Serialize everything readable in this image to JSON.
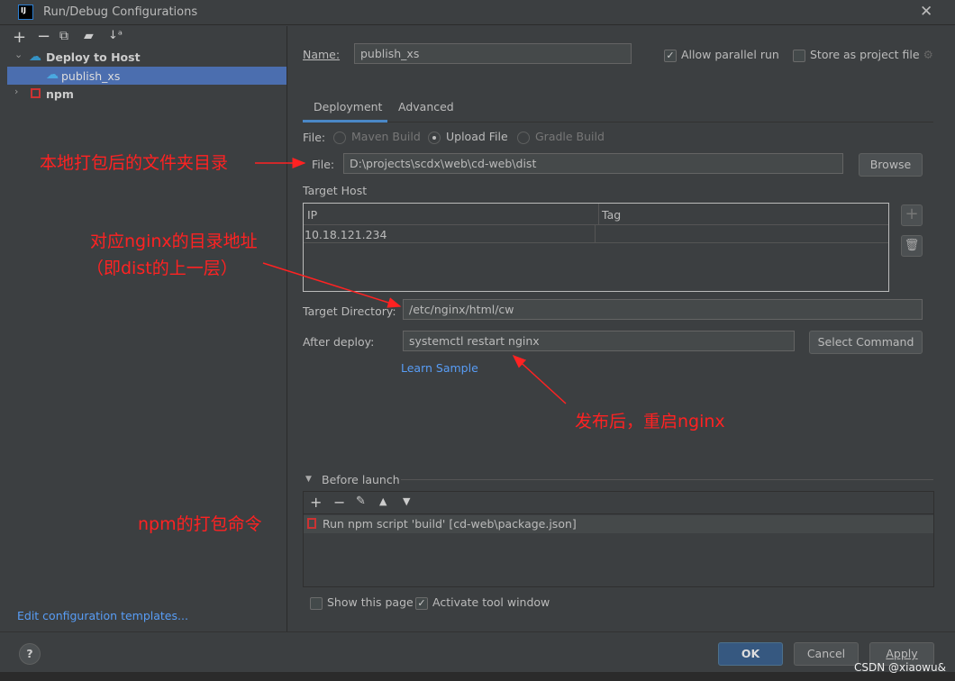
{
  "window": {
    "title": "Run/Debug Configurations",
    "close_icon": "close-icon"
  },
  "sidebar": {
    "toolbar": [
      "add-icon",
      "remove-icon",
      "copy-icon",
      "folder-add-icon",
      "sort-icon"
    ],
    "tree": [
      {
        "label": "Deploy to Host",
        "expanded": true,
        "children": [
          {
            "label": "publish_xs",
            "selected": true
          }
        ]
      },
      {
        "label": "npm",
        "expanded": false
      }
    ],
    "edit_templates": "Edit configuration templates..."
  },
  "form": {
    "name_label": "Name:",
    "name_value": "publish_xs",
    "allow_parallel": {
      "label": "Allow parallel run",
      "checked": true
    },
    "store_project": {
      "label": "Store as project file",
      "checked": false
    },
    "tabs": [
      {
        "label": "Deployment",
        "active": true
      },
      {
        "label": "Advanced",
        "active": false
      }
    ],
    "file_type_label": "File:",
    "file_types": [
      {
        "label": "Maven Build",
        "selected": false
      },
      {
        "label": "Upload File",
        "selected": true
      },
      {
        "label": "Gradle Build",
        "selected": false
      }
    ],
    "file_label": "File:",
    "file_value": "D:\\projects\\scdx\\web\\cd-web\\dist",
    "browse": "Browse",
    "target_host_label": "Target Host",
    "host_table": {
      "columns": [
        "IP",
        "Tag"
      ],
      "rows": [
        [
          "10.18.121.234",
          ""
        ]
      ]
    },
    "target_dir_label": "Target Directory:",
    "target_dir_value": "/etc/nginx/html/cw",
    "after_deploy_label": "After deploy:",
    "after_deploy_value": "systemctl restart nginx",
    "select_command": "Select Command",
    "learn_sample": "Learn Sample"
  },
  "before_launch": {
    "title": "Before launch",
    "items": [
      "Run npm script 'build' [cd-web\\package.json]"
    ],
    "show_page": {
      "label": "Show this page",
      "checked": false
    },
    "activate_tool": {
      "label": "Activate tool window",
      "checked": true
    }
  },
  "footer": {
    "help": "?",
    "ok": "OK",
    "cancel": "Cancel",
    "apply": "Apply"
  },
  "annotations": {
    "local_dir": "本地打包后的文件夹目录",
    "nginx_dir_1": "对应nginx的目录地址",
    "nginx_dir_2": "（即dist的上一层）",
    "restart": "发布后，重启nginx",
    "npm_cmd": "npm的打包命令",
    "color": "#ff2222"
  },
  "watermark": "CSDN @xiaowu&"
}
